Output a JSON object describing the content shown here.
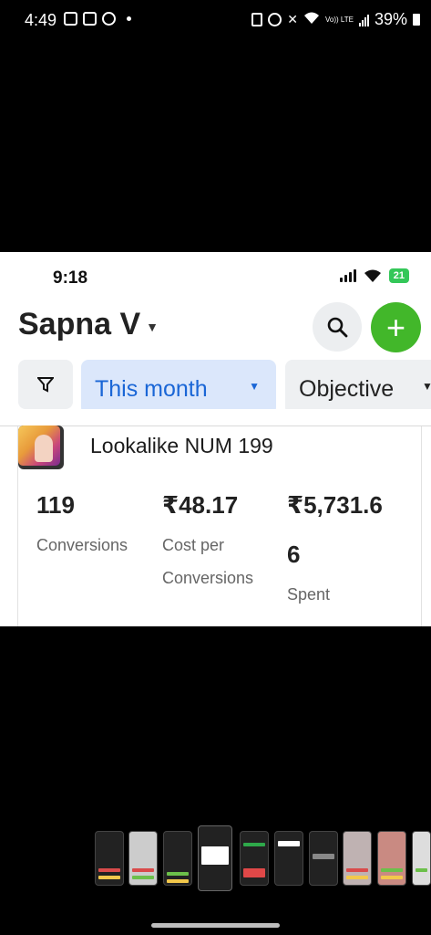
{
  "status_bar": {
    "time": "4:49",
    "battery": "39%",
    "network": "Vo)) LTE",
    "left_icons": [
      "gallery-icon",
      "instagram-icon",
      "app-icon"
    ],
    "right_icons": [
      "battery-saver-icon",
      "alarm-icon",
      "mute-icon",
      "wifi-icon",
      "signal-icon",
      "battery-icon"
    ]
  },
  "shot": {
    "ios_status": {
      "time": "9:18",
      "battery": "21"
    },
    "account": {
      "name": "Sapna V"
    },
    "filters": {
      "date_chip": "This month",
      "objective_chip": "Objective"
    },
    "ad": {
      "name": "Lookalike NUM 199",
      "metrics": [
        {
          "value": "119",
          "label": "Conversions"
        },
        {
          "value": "₹48.17",
          "label_line1": "Cost per",
          "label_line2": "Conversions"
        },
        {
          "value_line1": "₹5,731.6",
          "value_line2": "6",
          "label": "Spent"
        }
      ]
    }
  },
  "colors": {
    "accent_blue": "#1a66d6",
    "chip_blue_bg": "#dbe7fb",
    "add_green": "#42b72a"
  }
}
